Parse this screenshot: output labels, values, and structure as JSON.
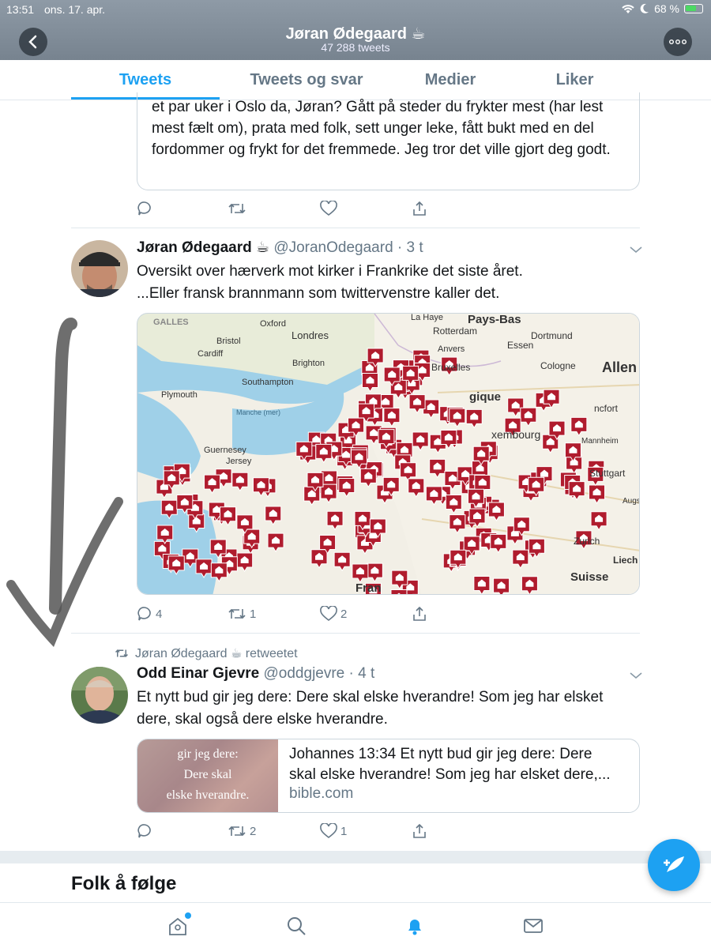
{
  "status": {
    "time": "13:51",
    "date": "ons. 17. apr.",
    "battery": "68 %"
  },
  "profile": {
    "name": "Jøran Ødegaard ☕",
    "tweet_count": "47 288 tweets"
  },
  "tabs": [
    {
      "label": "Tweets"
    },
    {
      "label": "Tweets og svar"
    },
    {
      "label": "Medier"
    },
    {
      "label": "Liker"
    }
  ],
  "quoted_tweet": {
    "text": "et par uker i Oslo da, Jøran? Gått på steder du frykter mest (har lest mest fælt om), prata med folk, sett unger leke, fått bukt med en del fordommer og frykt for det fremmede. Jeg tror det ville gjort deg godt."
  },
  "tweet1": {
    "name": "Jøran Ødegaard ☕",
    "handle": "@JoranOdegaard",
    "time": "· 3 t",
    "line1": "Oversikt over hærverk mot kirker i Frankrike det siste året.",
    "line2": "...Eller fransk brannmann som twittervenstre kaller det.",
    "replies": "4",
    "retweets": "1",
    "likes": "2",
    "map_labels": {
      "galles": "GALLES",
      "oxford": "Oxford",
      "londres": "Londres",
      "bristol": "Bristol",
      "cardiff": "Cardiff",
      "brighton": "Brighton",
      "southampton": "Southampton",
      "plymouth": "Plymouth",
      "manche": "Manche (mer)",
      "guernesey": "Guernesey",
      "jersey": "Jersey",
      "lahaye": "La Haye",
      "paysbas": "Pays-Bas",
      "rotterdam": "Rotterdam",
      "anvers": "Anvers",
      "essen": "Essen",
      "dortmund": "Dortmund",
      "cologne": "Cologne",
      "allem": "Allen",
      "bruxelles": "Bruxelles",
      "belgique": "gique",
      "francfort": "ncfort",
      "mannheim": "Mannheim",
      "luxembourg": "xembourg",
      "stuttgart": "Stuttgart",
      "augs": "Augs",
      "zurich": "Zurich",
      "suisse": "Suisse",
      "liech": "Liech",
      "fran": "Fran"
    }
  },
  "retweet": {
    "by": "Jøran Ødegaard ☕ retweetet"
  },
  "tweet2": {
    "name": "Odd Einar Gjevre",
    "handle": "@oddgjevre",
    "time": "· 4 t",
    "line1": "Et nytt bud gir jeg dere: Dere skal elske hverandre! Som jeg har elsket",
    "line2": "dere, skal også dere elske hverandre.",
    "card": {
      "title_line1": "Johannes 13:34 Et nytt bud gir jeg dere: Dere",
      "title_line2": "skal elske hverandre! Som jeg har elsket dere,...",
      "domain": "bible.com",
      "image_line1": "gir jeg dere:",
      "image_line2": "Dere skal",
      "image_line3": "elske hverandre."
    },
    "retweets": "2",
    "likes": "1"
  },
  "folk": {
    "title": "Folk å følge"
  }
}
